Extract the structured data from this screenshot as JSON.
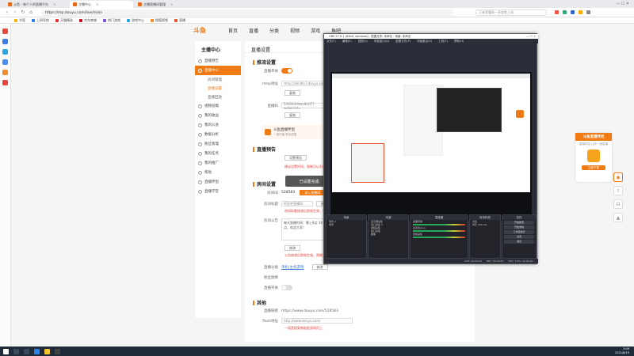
{
  "browser": {
    "tabs": [
      {
        "label": "斗鱼 - 每个人的直播平台"
      },
      {
        "label": "主播中心"
      },
      {
        "label": "主播直播间管理"
      }
    ],
    "url": "https://mp.douyu.com/live/main",
    "search_placeholder": "王者荣耀新一季皮肤上线",
    "bookmarks": [
      "书签",
      "上网导航",
      "天猫精选",
      "京东商城",
      "热门游戏",
      "游戏中心",
      "搜狐视频",
      "直播"
    ]
  },
  "site": {
    "logo": "斗鱼",
    "nav": [
      "首页",
      "直播",
      "分类",
      "视频",
      "游戏",
      "鱼吧"
    ],
    "sidebar": {
      "title": "主播中心",
      "items": [
        "直播预告",
        "直播中心",
        "房间管理",
        "直播设置",
        "直播回放",
        "视频投稿",
        "我的收益",
        "我的公会",
        "数据分析",
        "粉丝管理",
        "我的任务",
        "我的推广",
        "帮助",
        "直播伴侣",
        "直播学堂"
      ]
    },
    "content": {
      "page_title": "直播设置",
      "section1": "推流设置",
      "live_switch_label": "直播开关",
      "rtmp_label": "rtmp地址",
      "rtmp_value": "rtmp://sendtc3.douyu.com/live",
      "stream_label": "直播码",
      "stream_value": "528583rWqvBkQ7?wsSecret=",
      "copy_btn": "复制",
      "tip": "斗鱼直播伴侣",
      "tip_sub": "一键开播 更加便捷",
      "section2": "直播预告",
      "preview_label": "设置预告",
      "preview_warn": "建议设置时间，限制可以1分钟之前开播",
      "overlay_btn": "已设置完成",
      "section3": "房间设置",
      "room_id_label": "房间ID",
      "room_id_value": "528583",
      "room_tag": "进入直播间",
      "room_name_label": "房间标题",
      "room_name_value": "阿亚的直播间",
      "modify_btn": "修改",
      "room_warn": "房间标题修改后即刻生效，请遵守直播规范",
      "announce_label": "房间公告",
      "announce_value": "每天直播时间：晚上8点-10点，欢迎大家！",
      "announce_warn": "公告修改后即刻生效，限制为100字以内",
      "category_label": "直播分类",
      "category_value": "单机/主机游戏",
      "fans_label": "粉丝勋章",
      "other_label": "直播开关",
      "section4": "其他",
      "link_label": "直播链接",
      "link_value": "https://www.douyu.com/528583",
      "embed_label": "flash地址",
      "embed_value": "http://www.douyu.com/",
      "embed_warn": "一段直接复制粘贴到网页上"
    }
  },
  "promo": {
    "title": "斗鱼直播伴侣",
    "sub": "直播伴侣 让你一键直播",
    "btn": "立即下载"
  },
  "obs": {
    "title": "OBS 27.0.1 (64bit, windows) - 配置文件: 未命名 - 场景: 未命名",
    "menu": [
      "文件(F)",
      "编辑(E)",
      "视图(V)",
      "停靠窗口(D)",
      "配置文件(P)",
      "场景集合(S)",
      "工具(T)",
      "帮助(H)"
    ],
    "docks": {
      "scenes": {
        "title": "场景",
        "items": [
          "场景 2",
          "场景"
        ]
      },
      "sources": {
        "title": "来源",
        "items": [
          "显示器采集",
          "窗口采集 2",
          "视频采集",
          "窗口采集",
          "图像"
        ]
      },
      "mixer": {
        "title": "混音器",
        "items": [
          "桌面音频",
          "麦克风/Aux",
          "音频采集"
        ]
      },
      "transitions": {
        "title": "转场特效",
        "items": [
          "淡出",
          "时长 300 ms"
        ]
      },
      "controls": {
        "title": "控件",
        "items": [
          "开始推流",
          "开始录制",
          "工作室模式",
          "设置",
          "退出"
        ]
      }
    },
    "status": [
      "LIVE: 00:00:00",
      "REC: 00:00:00",
      "CPU: 3.6%, 30.00 fps"
    ]
  },
  "taskbar": {
    "time": "3:09",
    "date": "2021/8/19"
  }
}
